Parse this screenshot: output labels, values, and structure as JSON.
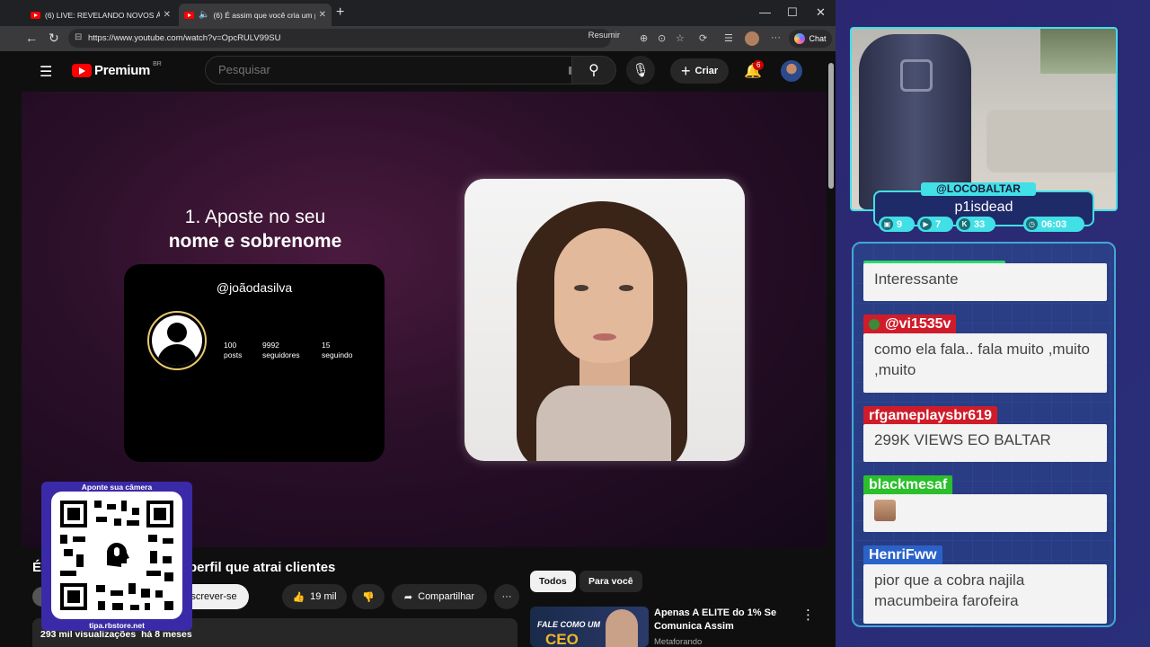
{
  "browser": {
    "tabs": [
      {
        "label": "(6) LIVE: REVELANDO NOVOS ÁUDIOS",
        "active": false
      },
      {
        "label": "(6) É assim que você cria um perfil",
        "active": true
      }
    ],
    "url": "https://www.youtube.com/watch?v=OpcRULV99SU",
    "resumir": "Resumir",
    "chat": "Chat"
  },
  "youtube": {
    "brand": "Premium",
    "region": "BR",
    "search_placeholder": "Pesquisar",
    "create": "Criar",
    "notifications": "6"
  },
  "video": {
    "heading_line1": "1. Aposte no seu",
    "heading_line2": "nome e sobrenome",
    "ig_handle": "@joãodasilva",
    "ig_stats": [
      {
        "value": "100",
        "label": "posts"
      },
      {
        "value": "9992",
        "label": "seguidores"
      },
      {
        "value": "15",
        "label": "seguindo"
      }
    ]
  },
  "watch": {
    "title_start": "É",
    "title_end": "perfil que atrai clientes",
    "subscribe": "screver-se",
    "likes": "19 mil",
    "share": "Compartilhar",
    "views": "293 mil visualizações",
    "age": "há 8 meses",
    "chips": [
      "Todos",
      "Para você"
    ],
    "rec_title": "Apenas A ELITE do 1% Se Comunica Assim",
    "rec_channel": "Metaforando",
    "rec_thumb_line1": "FALE COMO UM",
    "rec_thumb_line2": "CEO"
  },
  "qr": {
    "caption": "Aponte sua câmera",
    "url": "tipa.rbstore.net"
  },
  "stream": {
    "handle": "@LOCOBALTAR",
    "streamer": "p1isdead",
    "stats": [
      {
        "icon": "twitch-icon",
        "value": "9"
      },
      {
        "icon": "youtube-icon",
        "value": "7"
      },
      {
        "icon": "kick-icon",
        "value": "33"
      },
      {
        "icon": "clock-icon",
        "value": "06:03"
      }
    ]
  },
  "chat": {
    "messages": [
      {
        "user": "",
        "text": "Interessante",
        "color": "#2bd86e"
      },
      {
        "user": "@vi1535v",
        "text": "como ela fala.. fala muito ,muito ,muito",
        "color": "#d01c2a"
      },
      {
        "user": "rfgameplaysbr619",
        "text": "299K VIEWS EO BALTAR",
        "color": "#d01c2a"
      },
      {
        "user": "blackmesaf",
        "text": "",
        "color": "#2bbf2b"
      },
      {
        "user": "HenriFww",
        "text": "pior que a cobra najila macumbeira farofeira",
        "color": "#2a62c8"
      }
    ]
  }
}
